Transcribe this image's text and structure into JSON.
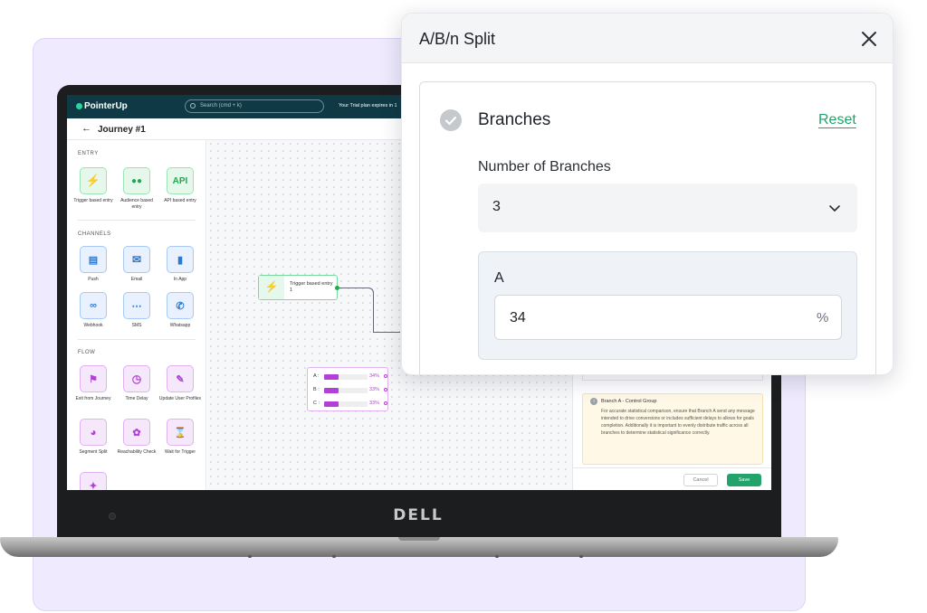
{
  "app": {
    "logo": "PointerUp",
    "search_placeholder": "Search (cmd + k)",
    "trial_text": "Your Trial plan expires in 1",
    "journey_title": "Journey #1",
    "back_icon": "arrow-left-icon"
  },
  "sidebar": {
    "entry_title": "ENTRY",
    "entry_items": [
      {
        "label": "Trigger based entry",
        "icon": "lightning-icon"
      },
      {
        "label": "Audience based entry",
        "icon": "audience-icon"
      },
      {
        "label": "API based entry",
        "icon": "api-icon",
        "glyph": "API"
      }
    ],
    "channels_title": "CHANNELS",
    "channel_items": [
      {
        "label": "Push",
        "icon": "push-icon"
      },
      {
        "label": "Email",
        "icon": "email-icon"
      },
      {
        "label": "In App",
        "icon": "in-app-icon"
      },
      {
        "label": "Webhook",
        "icon": "webhook-icon"
      },
      {
        "label": "SMS",
        "icon": "sms-icon"
      },
      {
        "label": "Whatsapp",
        "icon": "whatsapp-icon"
      }
    ],
    "flow_title": "FLOW",
    "flow_items": [
      {
        "label": "Exit from Journey",
        "icon": "flag-icon"
      },
      {
        "label": "Time Delay",
        "icon": "clock-icon"
      },
      {
        "label": "Update User Profiles",
        "icon": "user-edit-icon"
      },
      {
        "label": "Segment Split",
        "icon": "pie-icon"
      },
      {
        "label": "Reachability Check",
        "icon": "reachability-icon"
      },
      {
        "label": "Wait for Trigger",
        "icon": "hourglass-icon"
      }
    ]
  },
  "canvas": {
    "trigger_node_label": "Trigger based entry 1",
    "split_rows": [
      {
        "label": "A :",
        "percent": "34%",
        "value": 34
      },
      {
        "label": "B :",
        "percent": "33%",
        "value": 33
      },
      {
        "label": "C :",
        "percent": "33%",
        "value": 33
      }
    ]
  },
  "right_panel": {
    "info_title": "Branch A - Control Group",
    "info_body": "For accurate statistical comparison, ensure that Branch A send any message intended to drive conversions or includes sufficient delays to allows for goals completion. Additionally it is important to evenly distribute traffic across all branches to determine statistical significance correctly.",
    "cancel_label": "Cancel",
    "save_label": "Save"
  },
  "modal": {
    "title": "A/B/n Split",
    "section_title": "Branches",
    "reset_label": "Reset",
    "branches_label": "Number of Branches",
    "branches_value": "3",
    "branch_name": "A",
    "branch_percent": "34",
    "percent_symbol": "%"
  },
  "device": {
    "brand": "DELL"
  },
  "colors": {
    "accent_green": "#22a36b",
    "flow_purple": "#b43fd6",
    "channel_blue": "#2b7ad6",
    "entry_green": "#22a94f",
    "app_header": "#0f3a45",
    "background_lavender": "#efeafd"
  }
}
